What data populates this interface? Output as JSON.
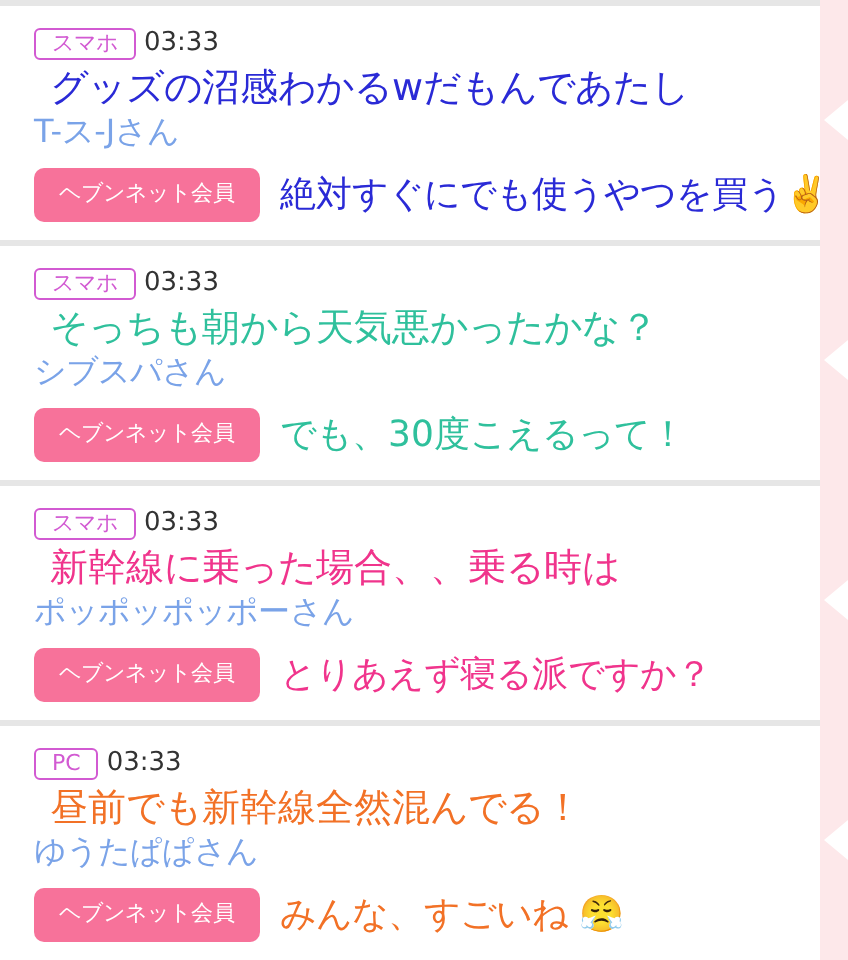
{
  "posts": [
    {
      "device": "スマホ",
      "time": "03:33",
      "name": "T-ス-Jさん",
      "member_badge": "ヘブンネット会員",
      "overlay": {
        "color": "#2a2ad6",
        "lines": [
          "グッズの沼感わかるwだもんであたし",
          "絶対すぐにでも使うやつを買う✌️"
        ]
      }
    },
    {
      "device": "スマホ",
      "time": "03:33",
      "name": "シブスパさん",
      "member_badge": "ヘブンネット会員",
      "overlay": {
        "color": "#2fc09c",
        "lines": [
          "そっちも朝から天気悪かったかな？",
          "でも、30度こえるって！"
        ]
      }
    },
    {
      "device": "スマホ",
      "time": "03:33",
      "name": "ポッポッポッポーさん",
      "member_badge": "ヘブンネット会員",
      "overlay": {
        "color": "#f0348c",
        "lines": [
          "新幹線に乗った場合、、乗る時は",
          "とりあえず寝る派ですか？"
        ]
      }
    },
    {
      "device": "PC",
      "time": "03:33",
      "name": "ゆうたぱぱさん",
      "member_badge": "ヘブンネット会員",
      "overlay": {
        "color": "#f27126",
        "lines": [
          "昼前でも新幹線全然混んでる！",
          "みんな、すごいね 😤"
        ]
      }
    }
  ]
}
